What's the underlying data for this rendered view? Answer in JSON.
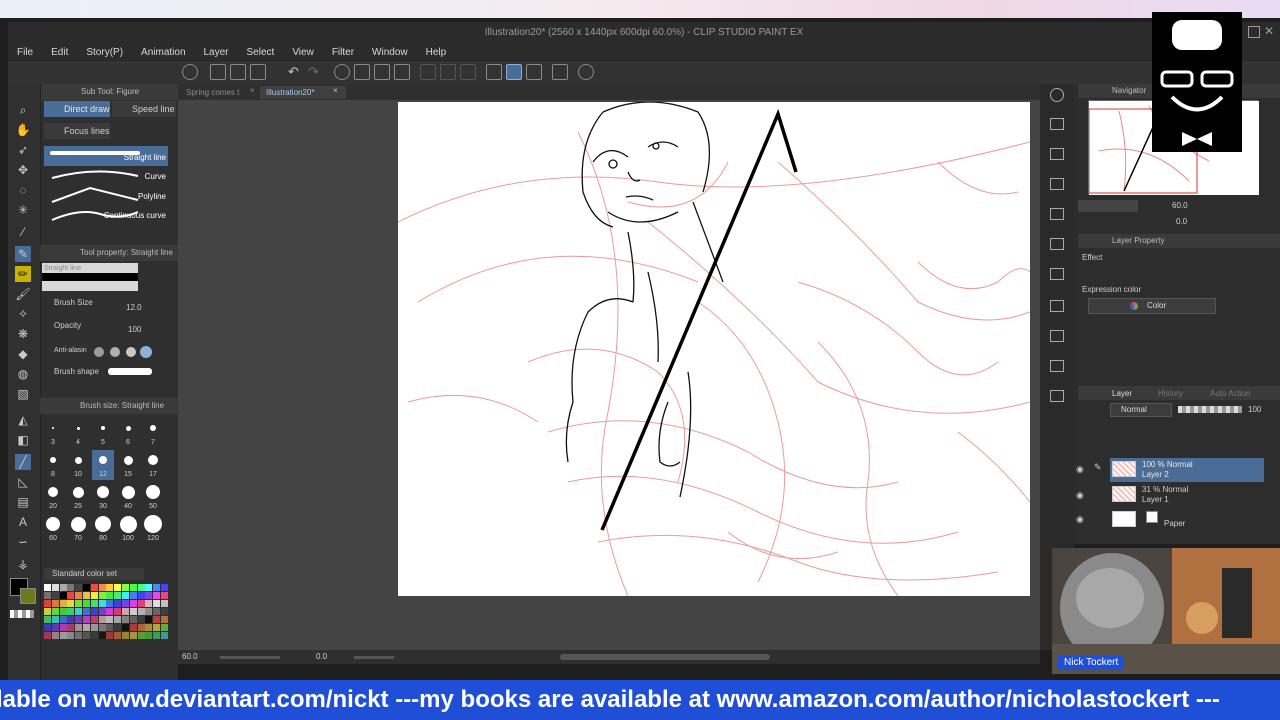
{
  "window": {
    "title": "Illustration20* (2560 x 1440px 600dpi 60.0%)  - CLIP STUDIO PAINT EX"
  },
  "menu": [
    "File",
    "Edit",
    "Story(P)",
    "Animation",
    "Layer",
    "Select",
    "View",
    "Filter",
    "Window",
    "Help"
  ],
  "doc_tabs": [
    "Spring comes t",
    "Illustration20*"
  ],
  "sub_tool": {
    "header": "Sub Tool: Figure",
    "groups": [
      "Direct draw",
      "Speed line",
      "Focus lines"
    ],
    "brushes": [
      "Straight line",
      "Curve",
      "Polyline",
      "Continuous curve"
    ]
  },
  "tool_property": {
    "header": "Tool property: Straight line",
    "name": "Straight line",
    "brush_size_label": "Brush Size",
    "brush_size_value": "12.0",
    "opacity_label": "Opacity",
    "opacity_value": "100",
    "antialias_label": "Anti-alasin",
    "brush_shape_label": "Brush shape"
  },
  "brush_size_panel": {
    "header": "Brush size: Straight line",
    "sizes": [
      "3",
      "4",
      "5",
      "6",
      "7",
      "8",
      "10",
      "12",
      "15",
      "17",
      "20",
      "25",
      "30",
      "40",
      "50",
      "60",
      "70",
      "80",
      "100",
      "120"
    ],
    "selected": "12"
  },
  "color_set": {
    "label": "Standard color set"
  },
  "navigator": {
    "header": "Navigator",
    "zoom": "60.0",
    "rotation": "0.0"
  },
  "layer_property": {
    "header": "Layer Property",
    "effect_label": "Effect",
    "expression_color_label": "Expression color",
    "expression_color_value": "Color"
  },
  "layer_panel": {
    "tabs": [
      "Layer",
      "History",
      "Auto Action"
    ],
    "blend_mode": "Normal",
    "opacity": "100",
    "layers": [
      {
        "mode": "100 % Normal",
        "name": "Layer 2",
        "selected": true
      },
      {
        "mode": "31 % Normal",
        "name": "Layer 1",
        "selected": false
      },
      {
        "mode": "",
        "name": "Paper",
        "selected": false
      }
    ]
  },
  "status": {
    "zoom": "60.0",
    "angle": "0.0"
  },
  "webcam": {
    "name": "Nick Tockert"
  },
  "ticker": {
    "text": "lable on www.deviantart.com/nickt ---my books are available at www.amazon.com/author/nicholastockert ---"
  },
  "colors": {
    "accent": "#4a6d97",
    "ticker_bg": "#1f4fd6",
    "sketch_red": "#e88a8a"
  }
}
